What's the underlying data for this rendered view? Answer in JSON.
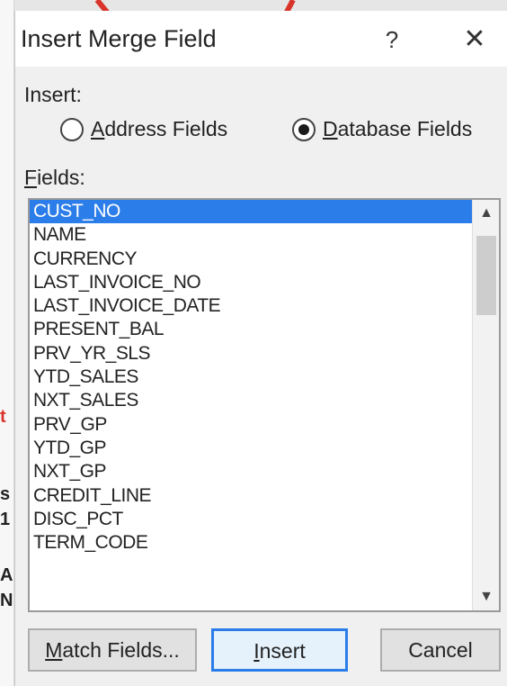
{
  "dialog": {
    "title": "Insert Merge Field",
    "help_label": "?",
    "close_label": "✕"
  },
  "insert_group": {
    "label": "Insert:",
    "options": [
      {
        "prefix": "",
        "accel": "A",
        "rest": "ddress Fields",
        "checked": false
      },
      {
        "prefix": "",
        "accel": "D",
        "rest": "atabase Fields",
        "checked": true
      }
    ]
  },
  "fields_label": {
    "accel": "F",
    "rest": "ields:"
  },
  "fields": [
    "CUST_NO",
    "NAME",
    "CURRENCY",
    "LAST_INVOICE_NO",
    "LAST_INVOICE_DATE",
    "PRESENT_BAL",
    "PRV_YR_SLS",
    "YTD_SALES",
    "NXT_SALES",
    "PRV_GP",
    "YTD_GP",
    "NXT_GP",
    "CREDIT_LINE",
    "DISC_PCT",
    "TERM_CODE"
  ],
  "selected_index": 0,
  "scrollbar": {
    "up_icon": "▲",
    "down_icon": "▼"
  },
  "buttons": {
    "match_fields": {
      "accel": "M",
      "rest": "atch Fields..."
    },
    "insert": {
      "accel": "I",
      "rest": "nsert"
    },
    "cancel": "Cancel"
  },
  "doc_fragments": [
    "t",
    "s",
    "1",
    "A",
    "N"
  ],
  "colors": {
    "selection": "#2b7de9",
    "arrow": "#d9342b"
  }
}
